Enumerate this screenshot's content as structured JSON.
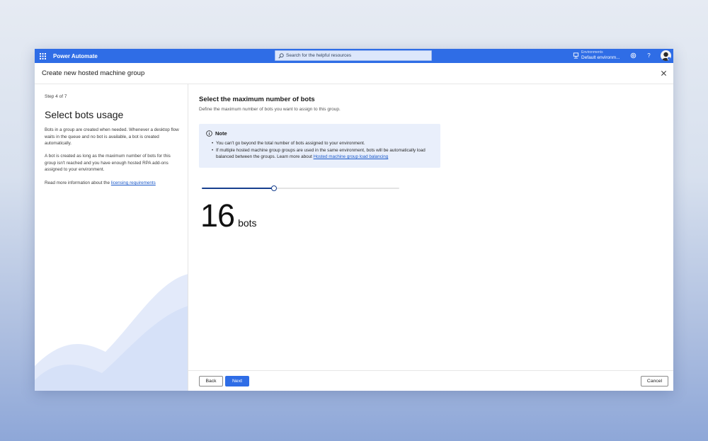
{
  "app": {
    "title": "Power Automate",
    "accent_color": "#2f6de6"
  },
  "topbar": {
    "waffle_icon": "waffle-icon",
    "search_placeholder": "Search for the helpful resources",
    "environments_label": "Environments",
    "environment_value": "Default environm...",
    "settings_icon": "gear-icon",
    "help_icon": "question-icon",
    "help_glyph": "?"
  },
  "dialog": {
    "title": "Create new hosted machine group",
    "close_icon": "close-icon"
  },
  "left": {
    "step": "Step 4 of 7",
    "heading": "Select bots usage",
    "para1": "Bots in a group are created when needed. Whenever a desktop flow waits in the queue and no bot is available, a bot is created automatically.",
    "para2": "A bot is created as long as the maximum number of bots for this group isn't reached and you have enough hosted RPA add-ons assigned to your environment.",
    "para3_prefix": "Read more information about the ",
    "para3_link": "licensing requirements"
  },
  "main": {
    "title": "Select the maximum number of bots",
    "description": "Define the maximum number of bots you want to assign to this group.",
    "note": {
      "title": "Note",
      "icon": "info-icon",
      "bullet1": "You can't go beyond the total number of bots assigned to your environment.",
      "bullet2_prefix": "If multiple hosted machine group groups are used in the same environment, bots will be automatically load balanced between the groups. Learn more about ",
      "bullet2_link": "Hosted machine group load balancing"
    },
    "slider_fraction": 0.365,
    "bots_value": "16",
    "bots_unit": "bots"
  },
  "footer": {
    "back_label": "Back",
    "next_label": "Next",
    "cancel_label": "Cancel"
  }
}
